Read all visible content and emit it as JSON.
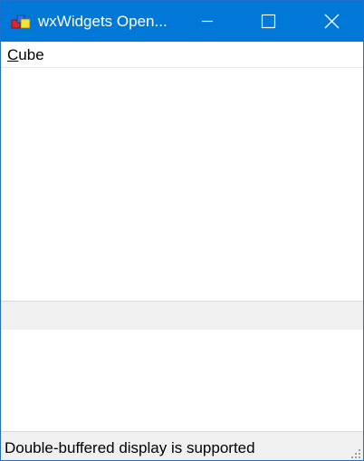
{
  "window": {
    "title": "wxWidgets Open...",
    "accent_color": "#0078d7",
    "icons": {
      "app": "app-icon",
      "minimize": "minimize-icon",
      "maximize": "maximize-icon",
      "close": "close-icon"
    }
  },
  "menubar": {
    "items": [
      {
        "mnemonic": "C",
        "rest": "ube"
      }
    ]
  },
  "statusbar": {
    "text": "Double-buffered display is supported"
  }
}
